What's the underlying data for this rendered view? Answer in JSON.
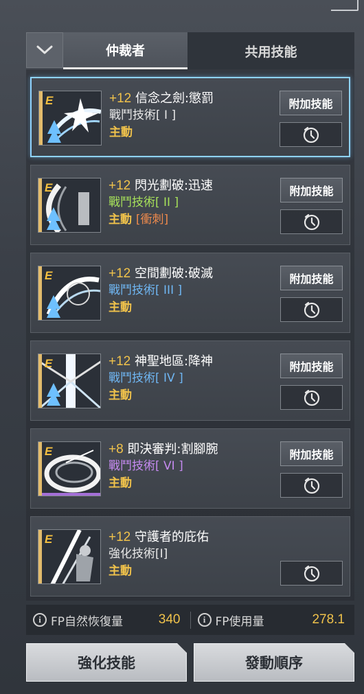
{
  "tabs": [
    {
      "label": "仲裁者",
      "active": true
    },
    {
      "label": "共用技能",
      "active": false
    }
  ],
  "colors": {
    "level": "#f0c24b",
    "mode": "#f0c24b",
    "selected_border": "#8fd3ff"
  },
  "skills": [
    {
      "grade": "E",
      "level": "+12",
      "name": "信念之劍:懲罰",
      "type": "戰鬥技術[ I ]",
      "type_color": "#e8e8e8",
      "mode": "主動",
      "mode_extra": "",
      "add_label": "附加技能",
      "has_add": true,
      "selected": true,
      "icon": "sword-slash-icon"
    },
    {
      "grade": "E",
      "level": "+12",
      "name": "閃光劃破:迅速",
      "type": "戰鬥技術[ II ]",
      "type_color": "#a6e05a",
      "mode": "主動",
      "mode_extra": "[衝刺]",
      "add_label": "附加技能",
      "has_add": true,
      "selected": false,
      "icon": "crescent-slash-icon"
    },
    {
      "grade": "E",
      "level": "+12",
      "name": "空間劃破:破滅",
      "type": "戰鬥技術[ III ]",
      "type_color": "#6fb6f2",
      "mode": "主動",
      "mode_extra": "",
      "add_label": "附加技能",
      "has_add": true,
      "selected": false,
      "icon": "spiral-blade-icon"
    },
    {
      "grade": "E",
      "level": "+12",
      "name": "神聖地區:降神",
      "type": "戰鬥技術[ IV ]",
      "type_color": "#6fb6f2",
      "mode": "主動",
      "mode_extra": "",
      "add_label": "附加技能",
      "has_add": true,
      "selected": false,
      "icon": "light-pillar-icon"
    },
    {
      "grade": "E",
      "level": "+8",
      "name": "即決審判:割腳腕",
      "type": "戰鬥技術[ VI ]",
      "type_color": "#c58af0",
      "mode": "主動",
      "mode_extra": "",
      "add_label": "附加技能",
      "has_add": true,
      "selected": false,
      "icon": "whirl-slash-icon"
    },
    {
      "grade": "E",
      "level": "+12",
      "name": "守護者的庇佑",
      "type": "強化技術[I]",
      "type_color": "#e8e8e8",
      "mode": "主動",
      "mode_extra": "",
      "add_label": "",
      "has_add": false,
      "selected": false,
      "icon": "guardian-blessing-icon"
    }
  ],
  "stats": {
    "fp_regen_label": "FP自然恢復量",
    "fp_regen_value": "340",
    "fp_use_label": "FP使用量",
    "fp_use_value": "278.1"
  },
  "buttons": {
    "enhance": "強化技能",
    "order": "發動順序"
  }
}
